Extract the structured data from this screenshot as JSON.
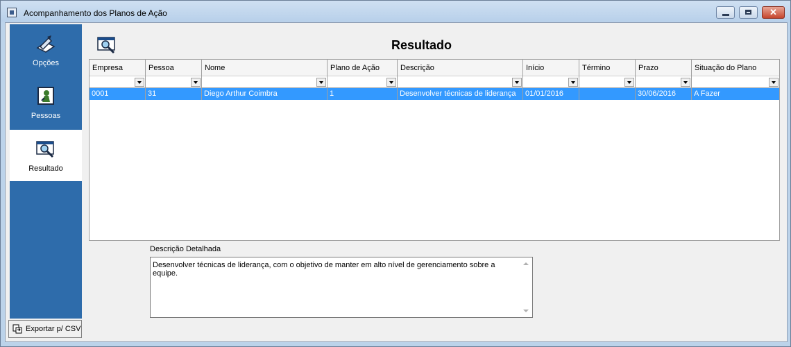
{
  "window": {
    "title": "Acompanhamento dos Planos de Ação",
    "buttons": {
      "minimize": "minimize-icon",
      "maximize": "maximize-icon",
      "close": "close-icon"
    }
  },
  "sidebar": {
    "items": [
      {
        "label": "Opções",
        "icon": "options-icon"
      },
      {
        "label": "Pessoas",
        "icon": "people-icon"
      },
      {
        "label": "Resultado",
        "icon": "result-icon",
        "active": true
      }
    ],
    "export_label": "Exportar p/ CSV"
  },
  "main": {
    "title": "Resultado",
    "grid": {
      "columns": [
        "Empresa",
        "Pessoa",
        "Nome",
        "Plano de Ação",
        "Descrição",
        "Início",
        "Término",
        "Prazo",
        "Situação do Plano"
      ],
      "rows": [
        [
          "0001",
          "31",
          "Diego Arthur Coimbra",
          "1",
          "Desenvolver técnicas de liderança",
          "01/01/2016",
          "",
          "30/06/2016",
          "A Fazer"
        ]
      ]
    },
    "detail": {
      "label": "Descrição Detalhada",
      "text": "Desenvolver técnicas de liderança, com o objetivo de manter em alto nível de gerenciamento sobre a equipe."
    }
  },
  "colors": {
    "accent": "#2e6cab",
    "selection": "#3399ff"
  }
}
